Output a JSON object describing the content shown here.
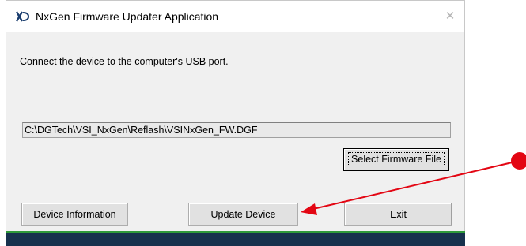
{
  "window": {
    "title": "NxGen Firmware Updater Application",
    "close_glyph": "✕"
  },
  "instruction": "Connect the device to the computer's USB port.",
  "firmware_path": "C:\\DGTech\\VSI_NxGen\\Reflash\\VSINxGen_FW.DGF",
  "buttons": {
    "select_firmware": "Select Firmware File",
    "device_information": "Device Information",
    "update_device": "Update Device",
    "exit": "Exit"
  },
  "colors": {
    "annotation_red": "#e30613",
    "taskbar": "#17314d",
    "taskbar_accent": "#2f9a3a"
  },
  "icons": {
    "app": "app-logo-icon",
    "close": "close-icon"
  }
}
